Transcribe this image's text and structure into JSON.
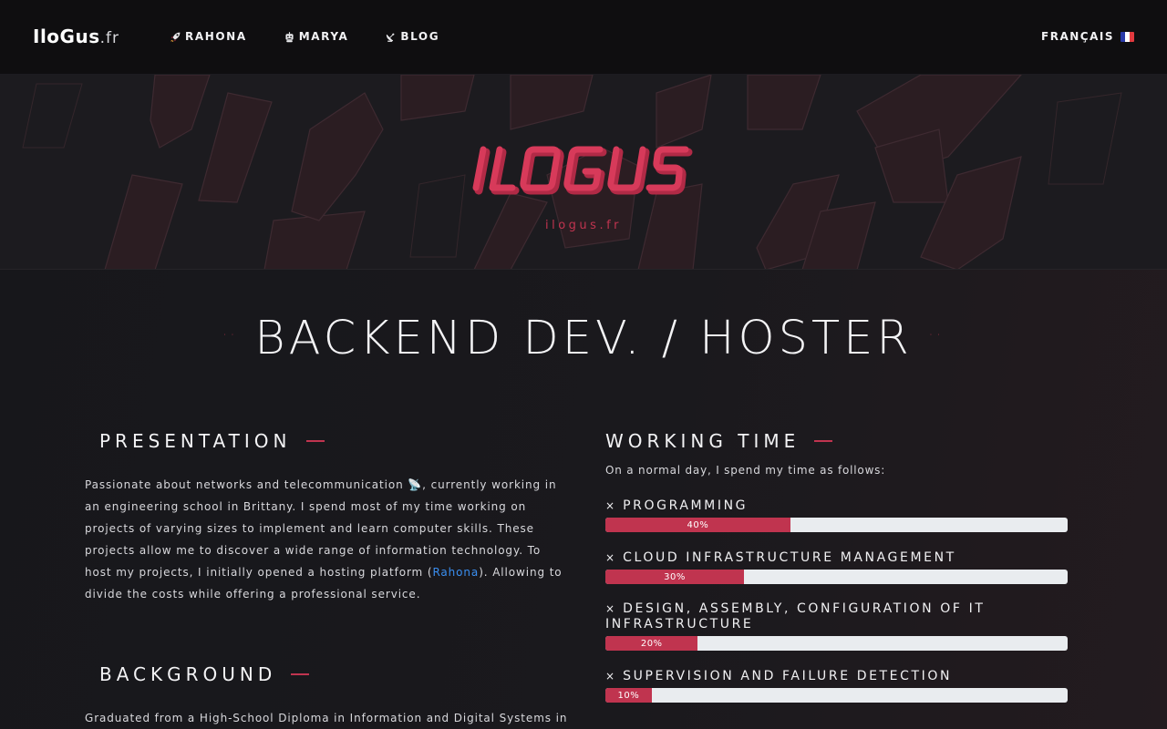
{
  "nav": {
    "brand": "IloGus",
    "brand_ext": ".fr",
    "links": [
      {
        "label": "RAHONA",
        "icon": "rocket-icon"
      },
      {
        "label": "MARYA",
        "icon": "robot-icon"
      },
      {
        "label": "BLOG",
        "icon": "satellite-icon"
      }
    ],
    "language": "FRANÇAIS",
    "flag_icon": "french-flag-icon"
  },
  "hero": {
    "logo_text": "ILOGUS",
    "subtitle": "ilogus.fr"
  },
  "main": {
    "title": "BACKEND DEV. / HOSTER",
    "title_deco": "··"
  },
  "presentation": {
    "heading": "PRESENTATION",
    "text_before": "Passionate about networks and telecommunication 📡, currently working in an engineering school in Brittany. I spend most of my time working on projects of varying sizes to implement and learn computer skills. These projects allow me to discover a wide range of information technology. To host my projects, I initially opened a hosting platform (",
    "link": "Rahona",
    "text_after": "). Allowing to divide the costs while offering a professional service."
  },
  "background": {
    "heading": "BACKGROUND",
    "text": "Graduated from a High-School Diploma in Information and Digital Systems in the"
  },
  "working_time": {
    "heading": "WORKING TIME",
    "intro": "On a normal day, I spend my time as follows:",
    "skills": [
      {
        "label": "PROGRAMMING",
        "percent": 40,
        "percent_label": "40%"
      },
      {
        "label": "CLOUD INFRASTRUCTURE MANAGEMENT",
        "percent": 30,
        "percent_label": "30%"
      },
      {
        "label": "DESIGN, ASSEMBLY, CONFIGURATION OF IT INFRASTRUCTURE",
        "percent": 20,
        "percent_label": "20%"
      },
      {
        "label": "SUPERVISION AND FAILURE DETECTION",
        "percent": 10,
        "percent_label": "10%"
      }
    ],
    "bullet": "×"
  },
  "colors": {
    "accent": "#c0344f",
    "bar_track": "#e9ecef",
    "link": "#3a8ef0",
    "navbar_bg": "#0f0e10",
    "page_bg": "#17171b"
  }
}
